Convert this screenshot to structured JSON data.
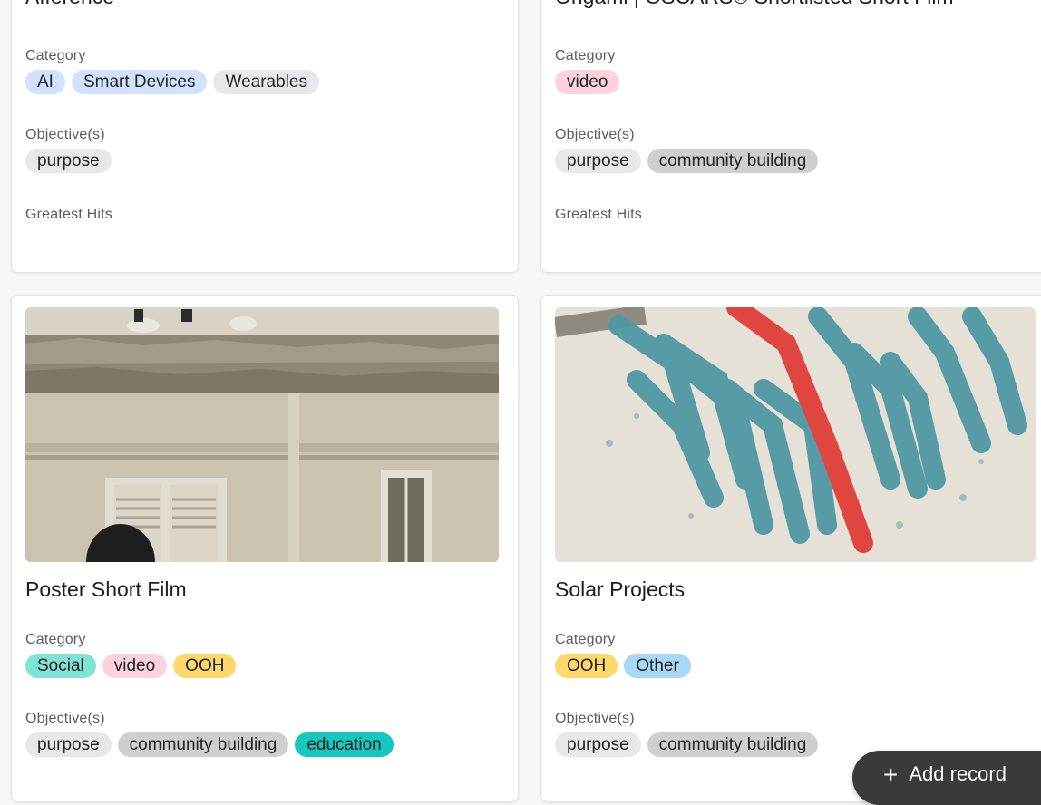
{
  "cards": [
    {
      "title": "Afference",
      "category_label": "Category",
      "categories": [
        {
          "label": "AI",
          "color": "#d0e2ff"
        },
        {
          "label": "Smart Devices",
          "color": "#d0e2ff"
        },
        {
          "label": "Wearables",
          "color": "#e8e8ec"
        }
      ],
      "objectives_label": "Objective(s)",
      "objectives": [
        {
          "label": "purpose",
          "color": "#e8e8e8"
        }
      ],
      "greatest_hits_label": "Greatest Hits"
    },
    {
      "title": "Origami | OSCARS® Shortlisted Short Film",
      "category_label": "Category",
      "categories": [
        {
          "label": "video",
          "color": "#fcd3dc"
        }
      ],
      "objectives_label": "Objective(s)",
      "objectives": [
        {
          "label": "purpose",
          "color": "#e8e8e8"
        },
        {
          "label": "community building",
          "color": "#cfcfcf"
        }
      ],
      "greatest_hits_label": "Greatest Hits"
    },
    {
      "title": "Poster Short Film",
      "image_icon": "building-facade-thumbnail",
      "category_label": "Category",
      "categories": [
        {
          "label": "Social",
          "color": "#7fe3d6"
        },
        {
          "label": "video",
          "color": "#fcd3dc"
        },
        {
          "label": "OOH",
          "color": "#ffd86b"
        }
      ],
      "objectives_label": "Objective(s)",
      "objectives": [
        {
          "label": "purpose",
          "color": "#e8e8e8"
        },
        {
          "label": "community building",
          "color": "#cfcfcf"
        },
        {
          "label": "education",
          "color": "#15c9c1"
        }
      ]
    },
    {
      "title": "Solar Projects",
      "image_icon": "abstract-tubes-thumbnail",
      "category_label": "Category",
      "categories": [
        {
          "label": "OOH",
          "color": "#ffd86b"
        },
        {
          "label": "Other",
          "color": "#a8d8f5"
        }
      ],
      "objectives_label": "Objective(s)",
      "objectives": [
        {
          "label": "purpose",
          "color": "#e8e8e8"
        },
        {
          "label": "community building",
          "color": "#cfcfcf"
        }
      ]
    }
  ],
  "add_record": {
    "icon": "plus-icon",
    "label": "Add record",
    "color": "#3a3a3a"
  }
}
